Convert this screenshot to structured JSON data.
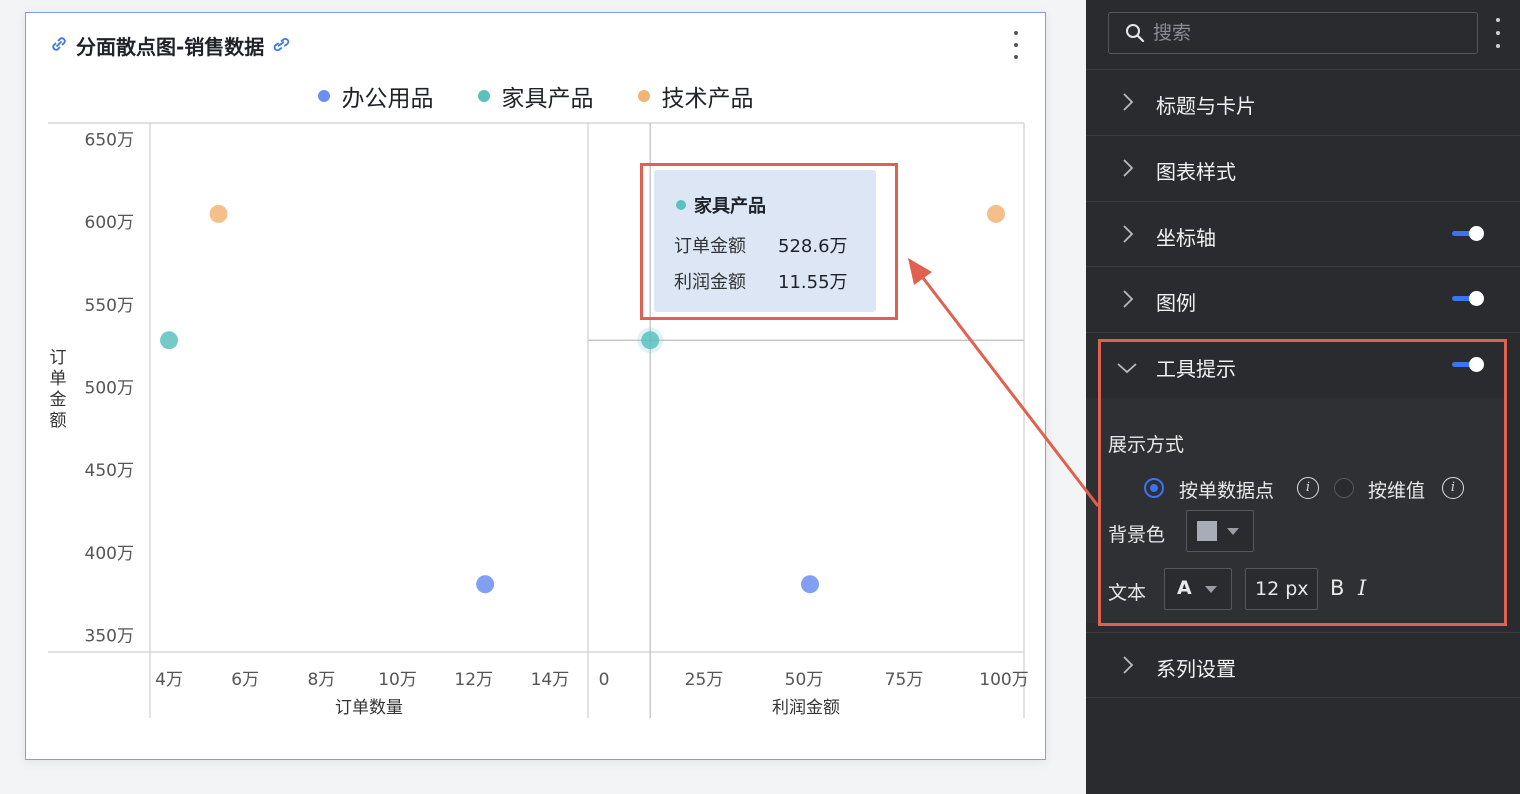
{
  "card": {
    "title": "分面散点图-销售数据"
  },
  "legend": [
    {
      "label": "办公用品",
      "color": "#6b8ff0"
    },
    {
      "label": "家具产品",
      "color": "#5ac1bf"
    },
    {
      "label": "技术产品",
      "color": "#f2b476"
    }
  ],
  "chart_data": [
    {
      "type": "scatter",
      "facet": "订单数量",
      "xlabel": "订单数量",
      "ylabel": "订单金额",
      "x_ticks": [
        "4万",
        "6万",
        "8万",
        "10万",
        "12万",
        "14万"
      ],
      "y_ticks": [
        "650万",
        "600万",
        "550万",
        "500万",
        "450万",
        "400万",
        "350万"
      ],
      "xlim": [
        3.5,
        15
      ],
      "ylim": [
        340,
        660
      ],
      "y_unit": "万",
      "series": [
        {
          "name": "办公用品",
          "points": [
            {
              "x": 12.3,
              "y": 381
            }
          ]
        },
        {
          "name": "家具产品",
          "points": [
            {
              "x": 4.0,
              "y": 528.6
            }
          ]
        },
        {
          "name": "技术产品",
          "points": [
            {
              "x": 5.3,
              "y": 605
            }
          ]
        }
      ]
    },
    {
      "type": "scatter",
      "facet": "利润金额",
      "xlabel": "利润金额",
      "ylabel": "订单金额",
      "x_ticks": [
        "0",
        "25万",
        "50万",
        "75万",
        "100万"
      ],
      "xlim": [
        -4,
        105
      ],
      "ylim": [
        340,
        660
      ],
      "series": [
        {
          "name": "办公用品",
          "points": [
            {
              "x": 51.5,
              "y": 381
            }
          ]
        },
        {
          "name": "家具产品",
          "points": [
            {
              "x": 11.55,
              "y": 528.6
            }
          ]
        },
        {
          "name": "技术产品",
          "points": [
            {
              "x": 98,
              "y": 605
            }
          ]
        }
      ]
    }
  ],
  "tooltip": {
    "series": "家具产品",
    "rows": [
      {
        "key": "订单金额",
        "value": "528.6万"
      },
      {
        "key": "利润金额",
        "value": "11.55万"
      }
    ]
  },
  "panel": {
    "search_placeholder": "搜索",
    "sections": [
      {
        "label": "标题与卡片",
        "toggle": false,
        "expanded": false
      },
      {
        "label": "图表样式",
        "toggle": false,
        "expanded": false
      },
      {
        "label": "坐标轴",
        "toggle": true,
        "expanded": false
      },
      {
        "label": "图例",
        "toggle": true,
        "expanded": false
      },
      {
        "label": "工具提示",
        "toggle": true,
        "expanded": true
      },
      {
        "label": "系列设置",
        "toggle": false,
        "expanded": false
      }
    ],
    "tooltip_settings": {
      "display_mode_label": "展示方式",
      "option_single": "按单数据点",
      "option_dimension": "按维值",
      "selected": "按单数据点",
      "bg_label": "背景色",
      "bg_color": "#a7acb6",
      "text_label": "文本",
      "font_glyph": "A",
      "font_size": "12 px",
      "bold": "B",
      "italic": "I"
    }
  }
}
